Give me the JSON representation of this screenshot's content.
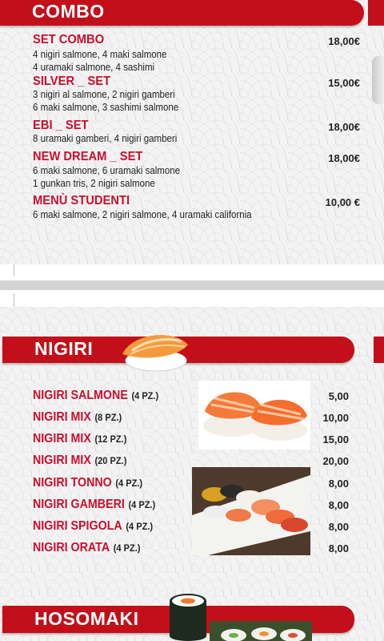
{
  "combo": {
    "title": "COMBO",
    "items": [
      {
        "name": "SET COMBO",
        "desc": [
          "4 nigiri salmone, 4 maki salmone",
          "4 uramaki salmone, 4 sashimi"
        ],
        "price": "18,00€"
      },
      {
        "name": "SILVER _ SET",
        "desc": [
          "3 nigiri al salmone, 2 nigiri gamberi",
          "6 maki salmone, 3 sashimi salmone"
        ],
        "price": "15,00€"
      },
      {
        "name": "EBI _ SET",
        "desc": [
          "8 uramaki gamberi, 4 nigiri gamberi"
        ],
        "price": "18,00€"
      },
      {
        "name": "NEW DREAM _ SET",
        "desc": [
          "6 maki salmone, 6 uramaki salmone",
          "1 gunkan tris, 2 nigiri salmone"
        ],
        "price": "18,00€"
      },
      {
        "name": "MENÙ STUDENTI",
        "desc": [
          "6 maki salmone, 2 nigiri salmone, 4 uramaki california"
        ],
        "price": "10,00 €"
      }
    ]
  },
  "nigiri": {
    "title": "NIGIRI",
    "items": [
      {
        "name": "NIGIRI SALMONE",
        "qty": "(4 PZ.)",
        "price": "5,00"
      },
      {
        "name": "NIGIRI MIX",
        "qty": "(8 PZ.)",
        "price": "10,00"
      },
      {
        "name": "NIGIRI MIX",
        "qty": "(12 PZ.)",
        "price": "15,00"
      },
      {
        "name": "NIGIRI MIX",
        "qty": "(20 PZ.)",
        "price": "20,00"
      },
      {
        "name": "NIGIRI TONNO",
        "qty": "(4 PZ.)",
        "price": "8,00"
      },
      {
        "name": "NIGIRI GAMBERI",
        "qty": "(4 PZ.)",
        "price": "8,00"
      },
      {
        "name": "NIGIRI SPIGOLA",
        "qty": "(4 PZ.)",
        "price": "8,00"
      },
      {
        "name": "NIGIRI ORATA",
        "qty": "(4 PZ.)",
        "price": "8,00"
      }
    ]
  },
  "hosomaki": {
    "title": "HOSOMAKI"
  },
  "colors": {
    "accent": "#c30f1a",
    "item_title": "#c8102e"
  }
}
